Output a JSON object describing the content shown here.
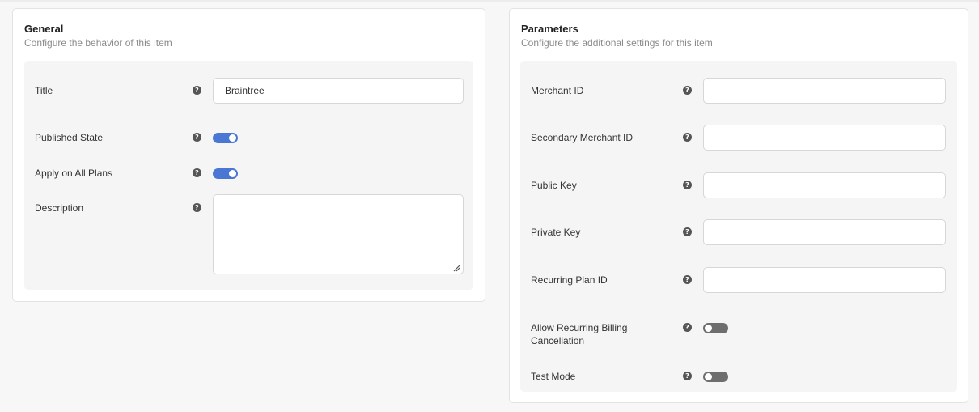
{
  "general": {
    "title": "General",
    "subtitle": "Configure the behavior of this item",
    "fields": {
      "title_label": "Title",
      "title_value": "Braintree",
      "published_label": "Published State",
      "published_on": true,
      "apply_label": "Apply on All Plans",
      "apply_on": true,
      "description_label": "Description",
      "description_value": ""
    }
  },
  "parameters": {
    "title": "Parameters",
    "subtitle": "Configure the additional settings for this item",
    "fields": {
      "merchant_id_label": "Merchant ID",
      "merchant_id_value": "",
      "secondary_merchant_id_label": "Secondary Merchant ID",
      "secondary_merchant_id_value": "",
      "public_key_label": "Public Key",
      "public_key_value": "",
      "private_key_label": "Private Key",
      "private_key_value": "",
      "recurring_plan_id_label": "Recurring Plan ID",
      "recurring_plan_id_value": "",
      "allow_cancel_label_line1": "Allow Recurring Billing",
      "allow_cancel_label_line2": "Cancellation",
      "allow_cancel_on": false,
      "test_mode_label": "Test Mode",
      "test_mode_on": false
    }
  },
  "icons": {
    "help": "question-circle-icon",
    "help_glyph": "?"
  },
  "colors": {
    "toggle_on": "#4a77d4",
    "toggle_off": "#6e6e6e"
  }
}
